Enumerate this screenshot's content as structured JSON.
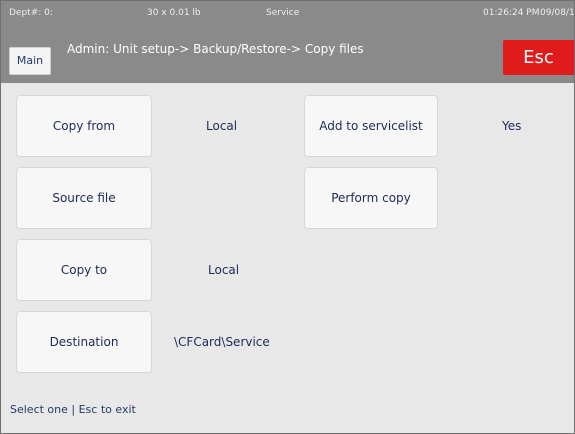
{
  "status": {
    "dept": "Dept#: 0:",
    "weight": "30 x 0.01 lb",
    "mode": "Service",
    "time": "01:26:24 PM",
    "date": "09/08/10"
  },
  "header": {
    "main_label": "Main",
    "title": "Admin: Unit setup-> Backup/Restore-> Copy files",
    "esc_label": "Esc"
  },
  "settings": {
    "copy_from": {
      "label": "Copy from",
      "value": "Local"
    },
    "source_file": {
      "label": "Source file"
    },
    "copy_to": {
      "label": "Copy to",
      "value": "Local"
    },
    "destination": {
      "label": "Destination",
      "value": "\\CFCard\\Service"
    },
    "add_to_servicelist": {
      "label": "Add to servicelist",
      "value": "Yes"
    },
    "perform_copy": {
      "label": "Perform copy"
    }
  },
  "footer": {
    "hint": "Select one | Esc to exit"
  },
  "colors": {
    "esc": "#e01b1b",
    "header": "#8a8a8a",
    "text": "#1c2b57"
  }
}
